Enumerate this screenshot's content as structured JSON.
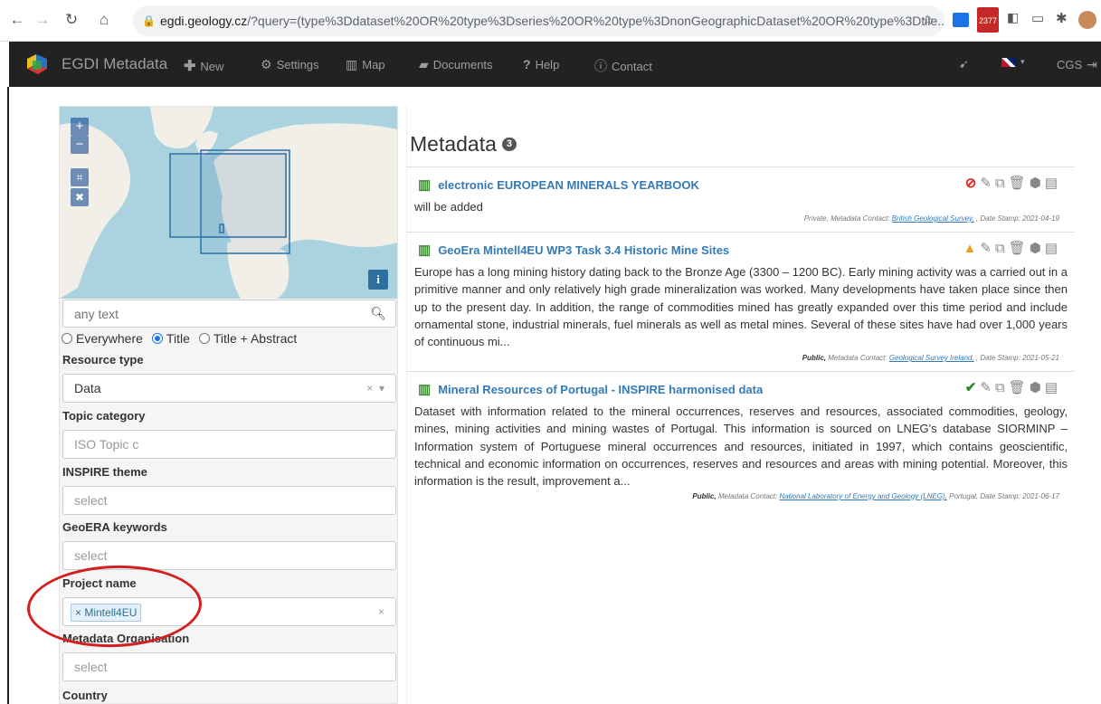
{
  "browser": {
    "url_host": "egdi.geology.cz",
    "url_path": "/?query=(type%3Ddataset%20OR%20type%3Dseries%20OR%20type%3DnonGeographicDataset%20OR%20type%3Dtile...",
    "calendar_badge": "2377"
  },
  "navbar": {
    "brand": "EGDI Metadata",
    "items": [
      "New",
      "Settings",
      "Map",
      "Documents",
      "Help",
      "Contact"
    ],
    "right": "CGS"
  },
  "search": {
    "placeholder": "any text"
  },
  "search_scope": {
    "options": [
      "Everywhere",
      "Title",
      "Title + Abstract"
    ],
    "selected": "Title"
  },
  "filters": [
    {
      "label": "Resource type",
      "value": "Data",
      "placeholder": ""
    },
    {
      "label": "Topic category",
      "value": "",
      "placeholder": "ISO Topic c"
    },
    {
      "label": "INSPIRE theme",
      "value": "",
      "placeholder": "select"
    },
    {
      "label": "GeoERA keywords",
      "value": "",
      "placeholder": "select"
    },
    {
      "label": "Project name",
      "value": "Mintell4EU",
      "placeholder": ""
    },
    {
      "label": "Metadata Organisation",
      "value": "",
      "placeholder": "select"
    },
    {
      "label": "Country",
      "value": "",
      "placeholder": ""
    }
  ],
  "results": {
    "title": "Metadata",
    "count": "3",
    "records": [
      {
        "title": "electronic EUROPEAN MINERALS YEARBOOK",
        "abstract": "will be added",
        "access": "Private,",
        "contact_label": "Metadata Contact:",
        "contact": "British Geological Survey,",
        "country": ",",
        "date": "Date Stamp: 2021-04-19",
        "status_icon": "forbidden-icon",
        "status_color": "#e02020"
      },
      {
        "title": "GeoEra Mintell4EU WP3 Task 3.4 Historic Mine Sites",
        "abstract": "Europe has a long mining history dating back to the Bronze Age (3300 – 1200 BC). Early mining activity was a carried out in a primitive manner and only relatively high grade mineralization was worked. Many developments have taken place since then up to the present day. In addition, the range of commodities mined has greatly expanded over this time period and include ornamental stone, industrial minerals, fuel minerals as well as metal mines. Several of these sites have had over 1,000 years of continuous mi...",
        "access": "Public,",
        "contact_label": "Metadata Contact:",
        "contact": "Geological Survey Ireland,",
        "country": ",",
        "date": "Date Stamp: 2021-05-21",
        "status_icon": "warning-icon",
        "status_color": "#f0a020"
      },
      {
        "title": "Mineral Resources of Portugal - INSPIRE harmonised data",
        "abstract": "Dataset with information related to the mineral occurrences, reserves and resources, associated commodities, geology, mines, mining activities and mining wastes of Portugal. This information is sourced on LNEG's database SIORMINP – Information system of Portuguese mineral occurrences and resources, initiated in 1997, which contains geoscientific, technical and economic information on occurrences, reserves and resources and areas with mining potential. Moreover, this information is the result, improvement a...",
        "access": "Public,",
        "contact_label": "Metadata Contact:",
        "contact": "National Laboratory of Energy and Geology (LNEG),",
        "country": "Portugal,",
        "date": "Date Stamp: 2021-06-17",
        "status_icon": "check-icon",
        "status_color": "#2a8a2a"
      }
    ]
  }
}
